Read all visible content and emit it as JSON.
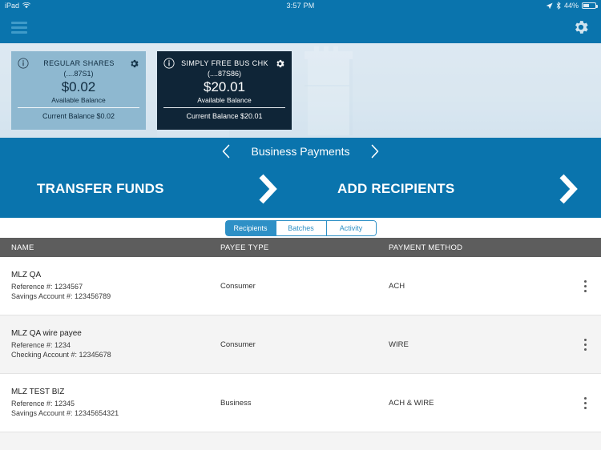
{
  "status_bar": {
    "device": "iPad",
    "wifi_icon": "wifi-icon",
    "time": "3:57 PM",
    "location_icon": "location-arrow-icon",
    "bluetooth_icon": "bluetooth-icon",
    "battery_percent": "44%",
    "battery_icon": "battery-icon"
  },
  "navbar": {
    "menu_icon": "hamburger-menu-icon",
    "settings_icon": "gear-icon",
    "background_color": "#0a74ad"
  },
  "accounts": [
    {
      "info_icon": "info-circle-icon",
      "title": "REGULAR SHARES",
      "mask": "(....87S1)",
      "amount": "$0.02",
      "amount_label": "Available Balance",
      "current_balance": "Current Balance $0.02",
      "gear_icon": "gear-icon",
      "theme": "light",
      "color": "#8eb8d0"
    },
    {
      "info_icon": "info-circle-icon",
      "title": "SIMPLY FREE BUS CHK",
      "mask": "(....87S86)",
      "amount": "$20.01",
      "amount_label": "Available Balance",
      "current_balance": "Current Balance $20.01",
      "gear_icon": "gear-icon",
      "theme": "dark",
      "color": "#0f2537"
    }
  ],
  "section": {
    "prev_icon": "chevron-left-icon",
    "title": "Business Payments",
    "next_icon": "chevron-right-icon"
  },
  "actions": [
    {
      "label": "TRANSFER FUNDS",
      "arrow_icon": "chevron-right-icon"
    },
    {
      "label": "ADD RECIPIENTS",
      "arrow_icon": "chevron-right-icon"
    }
  ],
  "tabs": [
    {
      "label": "Recipients",
      "active": true
    },
    {
      "label": "Batches",
      "active": false
    },
    {
      "label": "Activity",
      "active": false
    }
  ],
  "table": {
    "headers": {
      "name": "NAME",
      "payee_type": "PAYEE TYPE",
      "payment_method": "PAYMENT METHOD"
    },
    "rows": [
      {
        "name": "MLZ QA",
        "reference": "Reference #: 1234567",
        "account": "Savings Account #: 123456789",
        "payee_type": "Consumer",
        "payment_method": "ACH",
        "menu_icon": "kebab-menu-icon"
      },
      {
        "name": "MLZ QA wire payee",
        "reference": "Reference #: 1234",
        "account": "Checking Account #: 12345678",
        "payee_type": "Consumer",
        "payment_method": "WIRE",
        "menu_icon": "kebab-menu-icon"
      },
      {
        "name": "MLZ TEST BIZ",
        "reference": "Reference #: 12345",
        "account": "Savings Account #: 12345654321",
        "payee_type": "Business",
        "payment_method": "ACH & WIRE",
        "menu_icon": "kebab-menu-icon"
      }
    ]
  },
  "colors": {
    "brand_blue": "#0a74ad",
    "accent_blue": "#2e90c6",
    "header_gray": "#5d5d5d",
    "card_dark": "#0f2537",
    "card_light": "#8eb8d0"
  }
}
